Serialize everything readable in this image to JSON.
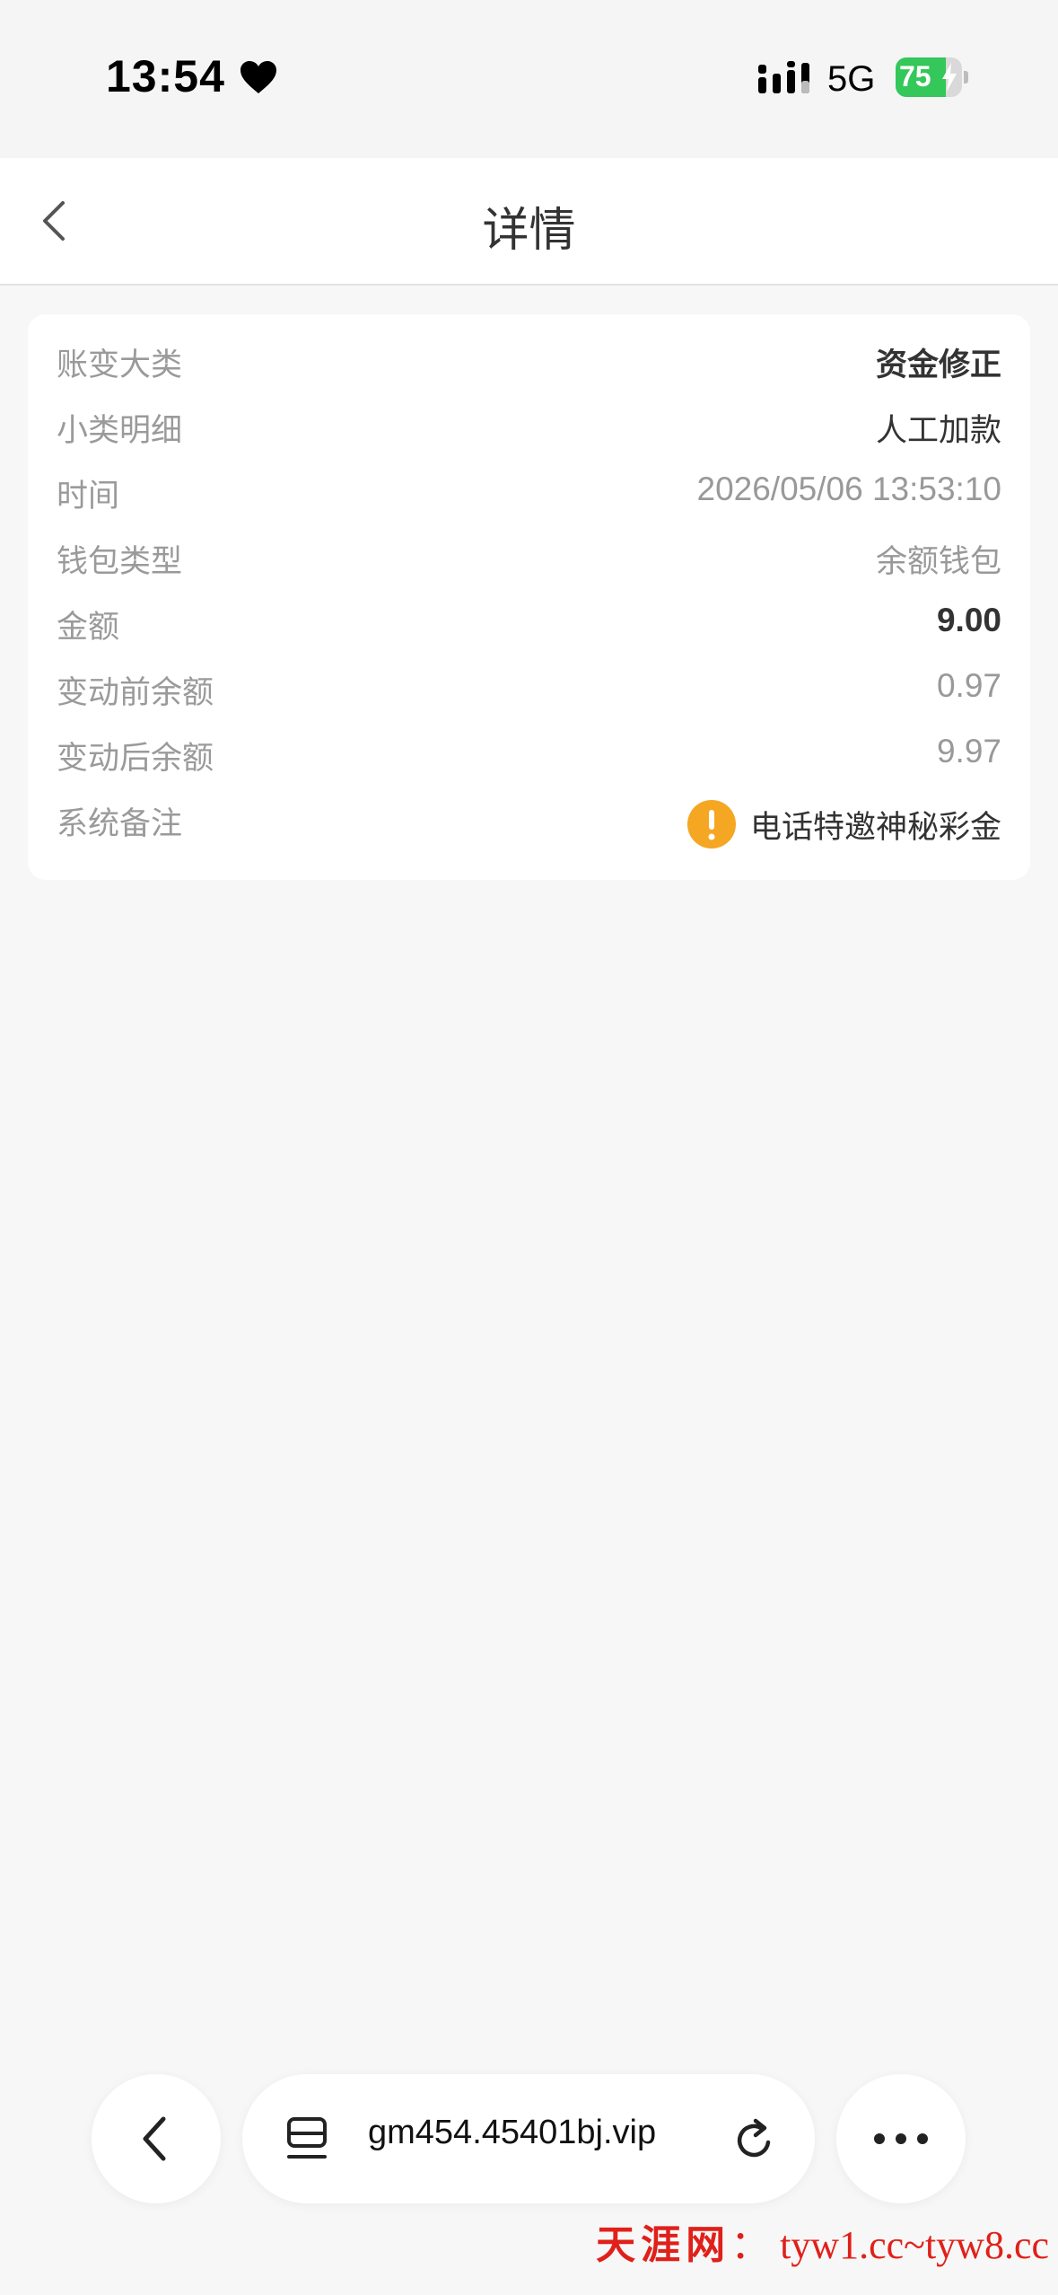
{
  "status_bar": {
    "time": "13:54",
    "network": "5G",
    "battery_level": 75,
    "battery_label": "75",
    "icons": [
      "heart-icon",
      "signal-icon",
      "battery-icon",
      "bolt-icon"
    ]
  },
  "nav": {
    "title": "详情",
    "back_icon": "chevron-left-icon"
  },
  "details": [
    {
      "label": "账变大类",
      "value": "资金修正"
    },
    {
      "label": "小类明细",
      "value": "人工加款"
    },
    {
      "label": "时间",
      "value": "2026/05/06 13:53:10"
    },
    {
      "label": "钱包类型",
      "value": "余额钱包"
    },
    {
      "label": "金额",
      "value": "9.00"
    },
    {
      "label": "变动前余额",
      "value": "0.97"
    },
    {
      "label": "变动后余额",
      "value": "9.97"
    },
    {
      "label": "系统备注",
      "value": "电话特邀神秘彩金",
      "icon": "warning-icon"
    }
  ],
  "browser": {
    "url": "gm454.45401bj.vip",
    "icons": [
      "chevron-left-icon",
      "tabs-icon",
      "reload-icon",
      "more-icon"
    ]
  },
  "watermark": {
    "name": "天涯网",
    "separator": "：",
    "urls": "tyw1.cc~tyw8.cc"
  },
  "colors": {
    "background": "#f7f7f7",
    "card": "#ffffff",
    "label": "#9a9a9a",
    "value_dark": "#333333",
    "warning": "#f5a623",
    "battery": "#34c759",
    "watermark": "#e0201a"
  }
}
